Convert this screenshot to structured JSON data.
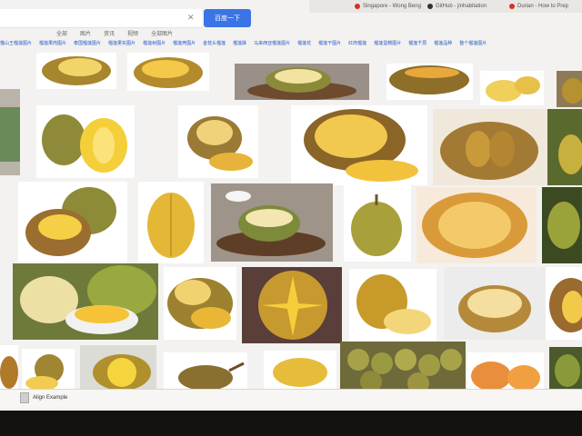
{
  "browser": {
    "tabs": [
      {
        "label": "Singapore - Wong Beng",
        "color": "#d93025"
      },
      {
        "label": "GitHub - jinhabitation",
        "color": "#333333"
      },
      {
        "label": "Durian - How to Prep",
        "color": "#d93025"
      }
    ]
  },
  "search": {
    "button_label": "百度一下",
    "clear_icon": "close-icon"
  },
  "filters": [
    "全部",
    "图片",
    "资讯",
    "视频",
    "全部图片"
  ],
  "related": [
    "猫山王榴莲图片",
    "榴莲果肉图片",
    "泰国榴莲图片",
    "榴莲果实图片",
    "榴莲树图片",
    "榴莲壳图片",
    "金枕头榴莲",
    "榴莲酥",
    "马来西亚榴莲图片",
    "榴莲花",
    "榴莲干图片",
    "红肉榴莲",
    "榴莲蛋糕图片",
    "榴莲千层",
    "榴莲品种",
    "整个榴莲图片"
  ],
  "download": {
    "file_label": "Align Example"
  }
}
